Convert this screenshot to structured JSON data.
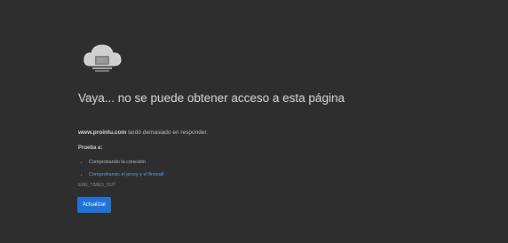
{
  "error_page": {
    "title": "Vaya... no se puede obtener acceso a esta página",
    "site": "www.prointu.com",
    "site_message": "tardó demasiado en responder.",
    "try_label": "Prueba a:",
    "suggestions": [
      {
        "text": "Comprobando la conexión",
        "link": false
      },
      {
        "text": "Comprobando el proxy y el firewall",
        "link": true
      }
    ],
    "error_code": "ERR_TIMED_OUT",
    "reload_label": "Actualizar"
  },
  "icon": "cloud-error-icon",
  "colors": {
    "background": "#2e2e2e",
    "accent": "#1e74d6",
    "link": "#5aa0e0"
  }
}
